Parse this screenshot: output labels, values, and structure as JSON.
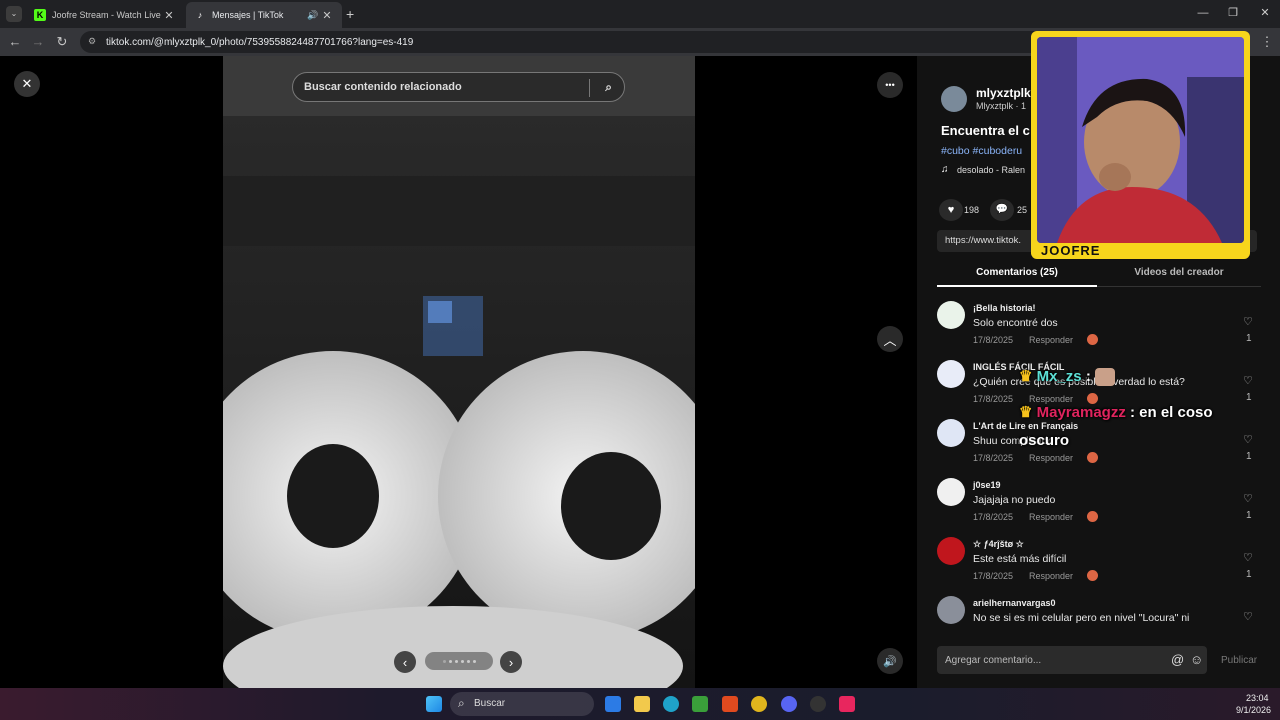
{
  "browser": {
    "tabs": [
      {
        "label": "Joofre Stream - Watch Live on K",
        "close": "✕"
      },
      {
        "label": "Mensajes | TikTok",
        "close": "✕"
      }
    ],
    "new_tab": "+",
    "url": "tiktok.com/@mlyxztplk_0/photo/7539558824487701766?lang=es-419"
  },
  "viewer": {
    "close_icon": "✕",
    "search_placeholder": "Buscar contenido relacionado",
    "more_icon": "•••"
  },
  "post": {
    "username": "mlyxztplk",
    "subname": "Mlyxztplk · 1",
    "title": "Encuentra el c",
    "hashtags": "#cubo #cuboderu",
    "music": "desolado - Ralen",
    "likes": "198",
    "comments_count": "25",
    "link": "https://www.tiktok."
  },
  "panel_tabs": {
    "comments": "Comentarios (25)",
    "creator_videos": "Videos del creador"
  },
  "comments": [
    {
      "name": "¡Bella historia!",
      "text": "Solo encontré dos",
      "date": "17/8/2025",
      "reply": "Responder",
      "likes": "1",
      "avatar_color": "#eaf3ea"
    },
    {
      "name": "INGLÉS FÁCIL FÁCIL",
      "text": "¿Quién cree que es posible... verdad lo está?",
      "date": "17/8/2025",
      "reply": "Responder",
      "likes": "1",
      "avatar_color": "#e8ecf8"
    },
    {
      "name": "L'Art de Lire en Français",
      "text": "Shuu complicado",
      "date": "17/8/2025",
      "reply": "Responder",
      "likes": "1",
      "avatar_color": "#dfe6f5"
    },
    {
      "name": "j0se19",
      "text": "Jajajaja no puedo",
      "date": "17/8/2025",
      "reply": "Responder",
      "likes": "1",
      "avatar_color": "#f0f0f0"
    },
    {
      "name": "☆ ƒ4rĵštø ☆",
      "text": "Este está más difícil",
      "date": "17/8/2025",
      "reply": "Responder",
      "likes": "1",
      "avatar_color": "#c0161d"
    },
    {
      "name": "arielhernanvargas0",
      "text": "No se si es mi celular pero en nivel \"Locura\" ni",
      "date": "",
      "reply": "",
      "likes": "",
      "avatar_color": "#8a8f9a"
    }
  ],
  "comment_input": {
    "placeholder": "Agregar comentario...",
    "publish": "Publicar"
  },
  "stream_overlay": {
    "channel": "JOOFRE",
    "chat": [
      {
        "user": "Mx_zs",
        "message": ":",
        "color": "#5de0d6"
      },
      {
        "user": "Mayramagzz",
        "message": ": en el coso oscuro",
        "color": "#e0245e"
      }
    ]
  },
  "taskbar": {
    "search": "Buscar",
    "time": "23:04",
    "date": "9/1/2026"
  }
}
